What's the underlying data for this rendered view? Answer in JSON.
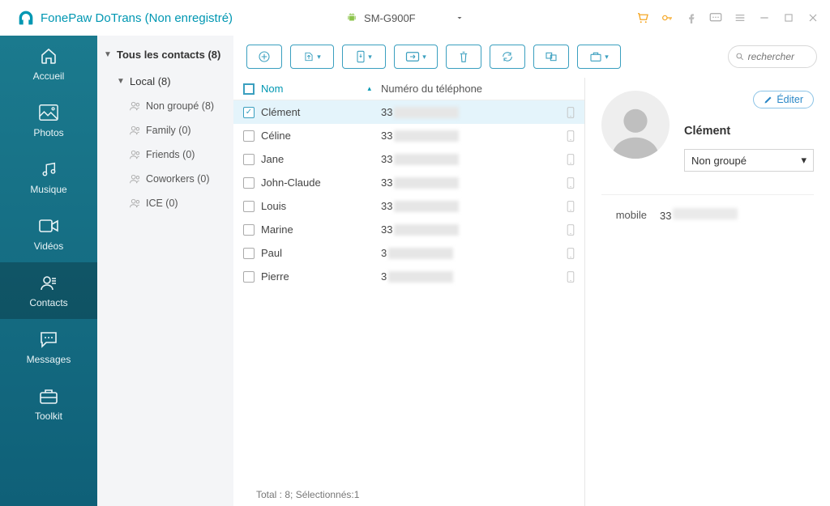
{
  "app": {
    "title": "FonePaw DoTrans (Non enregistré)",
    "device_name": "SM-G900F"
  },
  "rail": {
    "items": [
      {
        "id": "home",
        "label": "Accueil"
      },
      {
        "id": "photos",
        "label": "Photos"
      },
      {
        "id": "music",
        "label": "Musique"
      },
      {
        "id": "videos",
        "label": "Vidéos"
      },
      {
        "id": "contacts",
        "label": "Contacts"
      },
      {
        "id": "messages",
        "label": "Messages"
      },
      {
        "id": "toolkit",
        "label": "Toolkit"
      }
    ],
    "active": "contacts"
  },
  "tree": {
    "all_label": "Tous les contacts  (8)",
    "local_label": "Local  (8)",
    "groups": [
      {
        "label": "Non groupé  (8)"
      },
      {
        "label": "Family  (0)"
      },
      {
        "label": "Friends  (0)"
      },
      {
        "label": "Coworkers  (0)"
      },
      {
        "label": "ICE  (0)"
      }
    ]
  },
  "search": {
    "placeholder": "rechercher"
  },
  "table": {
    "col_name": "Nom",
    "col_phone": "Numéro du téléphone",
    "rows": [
      {
        "name": "Clément",
        "phone_visible": "33",
        "selected": true
      },
      {
        "name": "Céline",
        "phone_visible": "33",
        "selected": false
      },
      {
        "name": "Jane",
        "phone_visible": "33",
        "selected": false
      },
      {
        "name": "John-Claude",
        "phone_visible": "33",
        "selected": false
      },
      {
        "name": "Louis",
        "phone_visible": "33",
        "selected": false
      },
      {
        "name": "Marine",
        "phone_visible": "33",
        "selected": false
      },
      {
        "name": "Paul",
        "phone_visible": "3",
        "selected": false
      },
      {
        "name": "Pierre",
        "phone_visible": "3",
        "selected": false
      }
    ],
    "status": "Total : 8; Sélectionnés:1"
  },
  "details": {
    "edit_label": "Éditer",
    "contact_name": "Clément",
    "group_selected": "Non groupé",
    "phone_label": "mobile",
    "phone_visible": "33"
  }
}
